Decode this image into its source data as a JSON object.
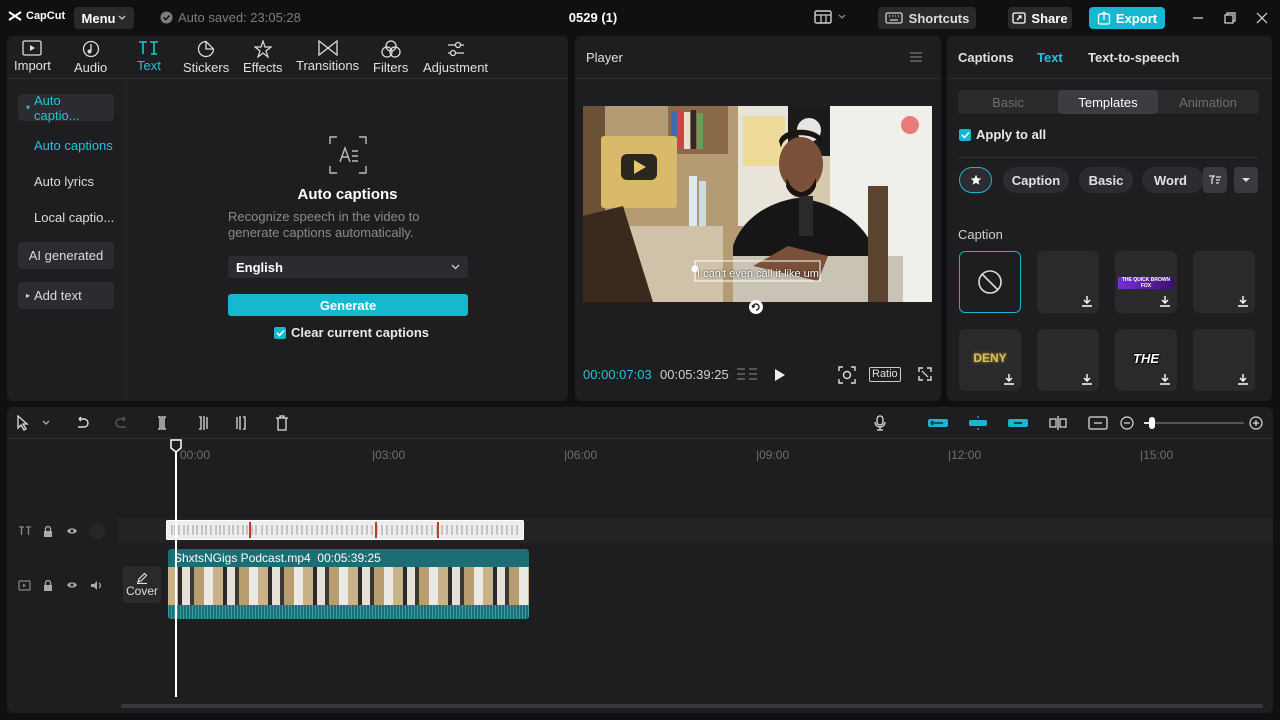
{
  "app": {
    "logo_text": "CapCut",
    "menu_label": "Menu",
    "autosave_text": "Auto saved: 23:05:28",
    "doc_title": "0529 (1)",
    "shortcuts_label": "Shortcuts",
    "share_label": "Share",
    "export_label": "Export",
    "accent_color": "#16b8cf"
  },
  "tool_tabs": [
    {
      "label": "Import",
      "icon": "import-icon"
    },
    {
      "label": "Audio",
      "icon": "audio-icon"
    },
    {
      "label": "Text",
      "icon": "text-icon",
      "active": true
    },
    {
      "label": "Stickers",
      "icon": "sticker-icon"
    },
    {
      "label": "Effects",
      "icon": "effects-icon"
    },
    {
      "label": "Transitions",
      "icon": "transitions-icon"
    },
    {
      "label": "Filters",
      "icon": "filters-icon"
    },
    {
      "label": "Adjustment",
      "icon": "adjustment-icon"
    }
  ],
  "left_nav": {
    "auto_captions_group": "Auto captio...",
    "sub_items": [
      "Auto captions",
      "Auto lyrics",
      "Local captio..."
    ],
    "ai_generated": "AI generated",
    "add_text": "Add text"
  },
  "auto_captions": {
    "title": "Auto captions",
    "description": "Recognize speech in the video to generate captions automatically.",
    "language": "English",
    "generate_label": "Generate",
    "clear_label": "Clear current captions",
    "clear_checked": true
  },
  "player": {
    "title": "Player",
    "subtitle_text": "I can't even call it like um",
    "current_time": "00:00:07:03",
    "total_time": "00:05:39:25",
    "ratio_label": "Ratio"
  },
  "right_panel": {
    "tabs": [
      "Captions",
      "Text",
      "Text-to-speech"
    ],
    "active_tab": "Text",
    "segments": [
      "Basic",
      "Templates",
      "Animation"
    ],
    "active_segment": "Templates",
    "apply_all_label": "Apply to all",
    "apply_all_checked": true,
    "chips": [
      "Caption",
      "Basic",
      "Word"
    ],
    "section_label": "Caption",
    "tiles": [
      {
        "label": "",
        "kind": "none"
      },
      {
        "label": "",
        "kind": "blank"
      },
      {
        "label": "THE QUICK BROWN FOX",
        "kind": "template"
      },
      {
        "label": "",
        "kind": "blank"
      },
      {
        "label": "DENY",
        "kind": "template"
      },
      {
        "label": "",
        "kind": "blank"
      },
      {
        "label": "THE",
        "kind": "template"
      },
      {
        "label": "",
        "kind": "blank"
      }
    ]
  },
  "timeline": {
    "ruler_labels": [
      "00:00",
      "03:00",
      "06:00",
      "09:00",
      "12:00",
      "15:00"
    ],
    "video_clip_name": "ShxtsNGigs Podcast.mp4",
    "video_clip_duration": "00:05:39:25",
    "cover_label": "Cover",
    "zoom_level": 0.08
  }
}
